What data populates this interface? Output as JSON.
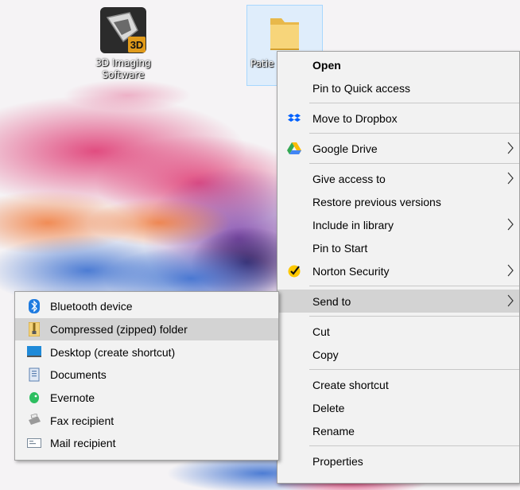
{
  "desktop": {
    "icons": [
      {
        "label": "3D Imaging Software"
      },
      {
        "label": "Patie"
      }
    ],
    "app_icon_text": "3D"
  },
  "context_menu": {
    "items": [
      {
        "label": "Open"
      },
      {
        "label": "Pin to Quick access"
      },
      {
        "label": "Move to Dropbox",
        "icon": "dropbox-icon"
      },
      {
        "label": "Google Drive",
        "icon": "google-drive-icon"
      },
      {
        "label": "Give access to"
      },
      {
        "label": "Restore previous versions"
      },
      {
        "label": "Include in library"
      },
      {
        "label": "Pin to Start"
      },
      {
        "label": "Norton Security",
        "icon": "norton-icon"
      },
      {
        "label": "Send to"
      },
      {
        "label": "Cut"
      },
      {
        "label": "Copy"
      },
      {
        "label": "Create shortcut"
      },
      {
        "label": "Delete"
      },
      {
        "label": "Rename"
      },
      {
        "label": "Properties"
      }
    ]
  },
  "sendto_menu": {
    "items": [
      {
        "label": "Bluetooth device",
        "icon": "bluetooth-icon"
      },
      {
        "label": "Compressed (zipped) folder",
        "icon": "zip-folder-icon"
      },
      {
        "label": "Desktop (create shortcut)",
        "icon": "desktop-icon"
      },
      {
        "label": "Documents",
        "icon": "documents-icon"
      },
      {
        "label": "Evernote",
        "icon": "evernote-icon"
      },
      {
        "label": "Fax recipient",
        "icon": "fax-icon"
      },
      {
        "label": "Mail recipient",
        "icon": "mail-icon"
      }
    ]
  },
  "colors": {
    "menu_bg": "#f2f2f2",
    "menu_highlight": "#d3d3d3",
    "selection_bg": "#cce8ff"
  }
}
